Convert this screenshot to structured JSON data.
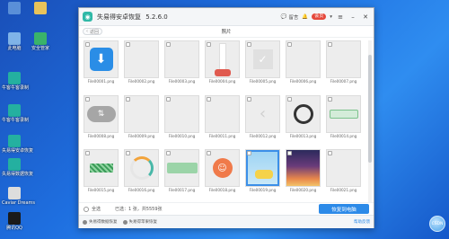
{
  "desktop": {
    "icons": [
      {
        "label": "",
        "icon": "recycle-bin-icon",
        "color": "#5a8fd8"
      },
      {
        "label": "",
        "icon": "folder-icon",
        "color": "#e8c35a"
      },
      {
        "label": "此电脑",
        "icon": "computer-icon",
        "color": "#7fb3e8"
      },
      {
        "label": "安全管家",
        "icon": "shield-icon",
        "color": "#3ab36a"
      },
      {
        "label": "牛客牛客录制",
        "icon": "app-icon-1",
        "color": "#24b0a0"
      },
      {
        "label": "牛客牛客录制",
        "icon": "app-icon-2",
        "color": "#24b0a0"
      },
      {
        "label": "失易得安卓恢复",
        "icon": "app-icon-3",
        "color": "#24b0a0"
      },
      {
        "label": "失易得数据恢复",
        "icon": "app-icon-4",
        "color": "#24b0a0"
      },
      {
        "label": "Caviar Dreams",
        "icon": "font-icon",
        "color": "#dddddd"
      },
      {
        "label": "腾讯QQ",
        "icon": "qq-icon",
        "color": "#1a1a1a"
      }
    ]
  },
  "window": {
    "title": "失易得安卓恢复",
    "version": "5.2.6.0",
    "message_label": "留言",
    "vip_label": "会员",
    "back_label": "返回",
    "section_title": "照片"
  },
  "photos": [
    {
      "name": "File00001.png",
      "kind": "download"
    },
    {
      "name": "File00002.png",
      "kind": "blank"
    },
    {
      "name": "File00003.png",
      "kind": "blank"
    },
    {
      "name": "File00004.png",
      "kind": "red-strip"
    },
    {
      "name": "File00005.png",
      "kind": "check"
    },
    {
      "name": "File00006.png",
      "kind": "blank"
    },
    {
      "name": "File00007.png",
      "kind": "blank"
    },
    {
      "name": "File00008.png",
      "kind": "arrow-pill"
    },
    {
      "name": "File00009.png",
      "kind": "blank"
    },
    {
      "name": "File00010.png",
      "kind": "blank"
    },
    {
      "name": "File00011.png",
      "kind": "blank"
    },
    {
      "name": "File00012.png",
      "kind": "chevron"
    },
    {
      "name": "File00013.png",
      "kind": "ring"
    },
    {
      "name": "File00014.png",
      "kind": "green-pill"
    },
    {
      "name": "File00015.png",
      "kind": "stripes"
    },
    {
      "name": "File00016.png",
      "kind": "arc"
    },
    {
      "name": "File00017.png",
      "kind": "green-bar"
    },
    {
      "name": "File00018.png",
      "kind": "avatar-orange"
    },
    {
      "name": "File00019.png",
      "kind": "cartoon"
    },
    {
      "name": "File00020.png",
      "kind": "sunset"
    },
    {
      "name": "File00021.png",
      "kind": "blank"
    }
  ],
  "bottom": {
    "select_all_label": "全选",
    "selected_text": "已选：1 张，共5559张",
    "restore_button": "恢复到电脑"
  },
  "footer": {
    "item1": "失易得数据恢复",
    "item2": "失易得苹果恢复",
    "help_link": "帮助反馈"
  },
  "bubble_text": "CSDN"
}
